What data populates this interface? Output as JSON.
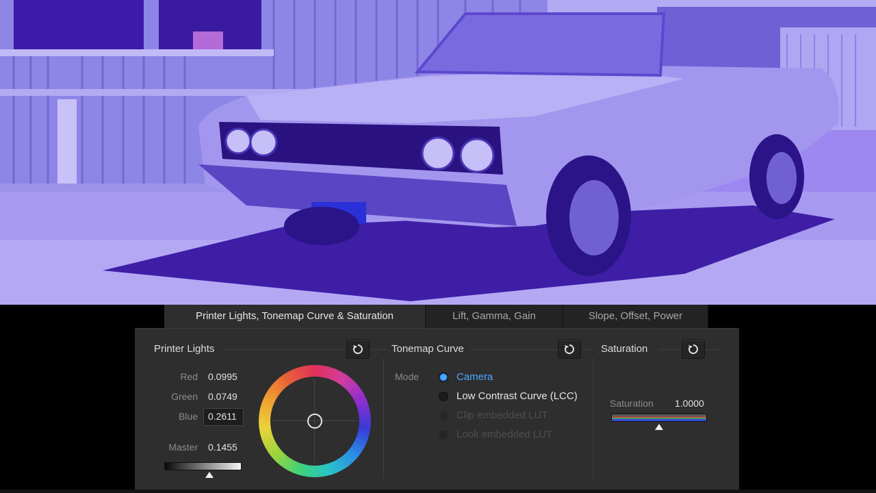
{
  "tabs": [
    {
      "label": "Printer Lights, Tonemap Curve & Saturation",
      "active": true
    },
    {
      "label": "Lift, Gamma, Gain",
      "active": false
    },
    {
      "label": "Slope, Offset, Power",
      "active": false
    }
  ],
  "printer_lights": {
    "title": "Printer Lights",
    "red_label": "Red",
    "red_value": "0.0995",
    "green_label": "Green",
    "green_value": "0.0749",
    "blue_label": "Blue",
    "blue_value": "0.2611",
    "master_label": "Master",
    "master_value": "0.1455",
    "master_slider_fraction": 0.58
  },
  "tonemap": {
    "title": "Tonemap Curve",
    "mode_label": "Mode",
    "options": [
      {
        "label": "Camera",
        "selected": true,
        "enabled": true
      },
      {
        "label": "Low Contrast Curve (LCC)",
        "selected": false,
        "enabled": true
      },
      {
        "label": "Clip embedded LUT",
        "selected": false,
        "enabled": false
      },
      {
        "label": "Look embedded LUT",
        "selected": false,
        "enabled": false
      }
    ]
  },
  "saturation": {
    "title": "Saturation",
    "label": "Saturation",
    "value": "1.0000",
    "slider_fraction": 0.5
  },
  "icons": {
    "reset": "reset-icon",
    "color_wheel": "color-wheel"
  },
  "colors": {
    "accent": "#4aa9ff",
    "panel_bg": "#2e2e2e",
    "image_tint": "#8f7ce8"
  }
}
